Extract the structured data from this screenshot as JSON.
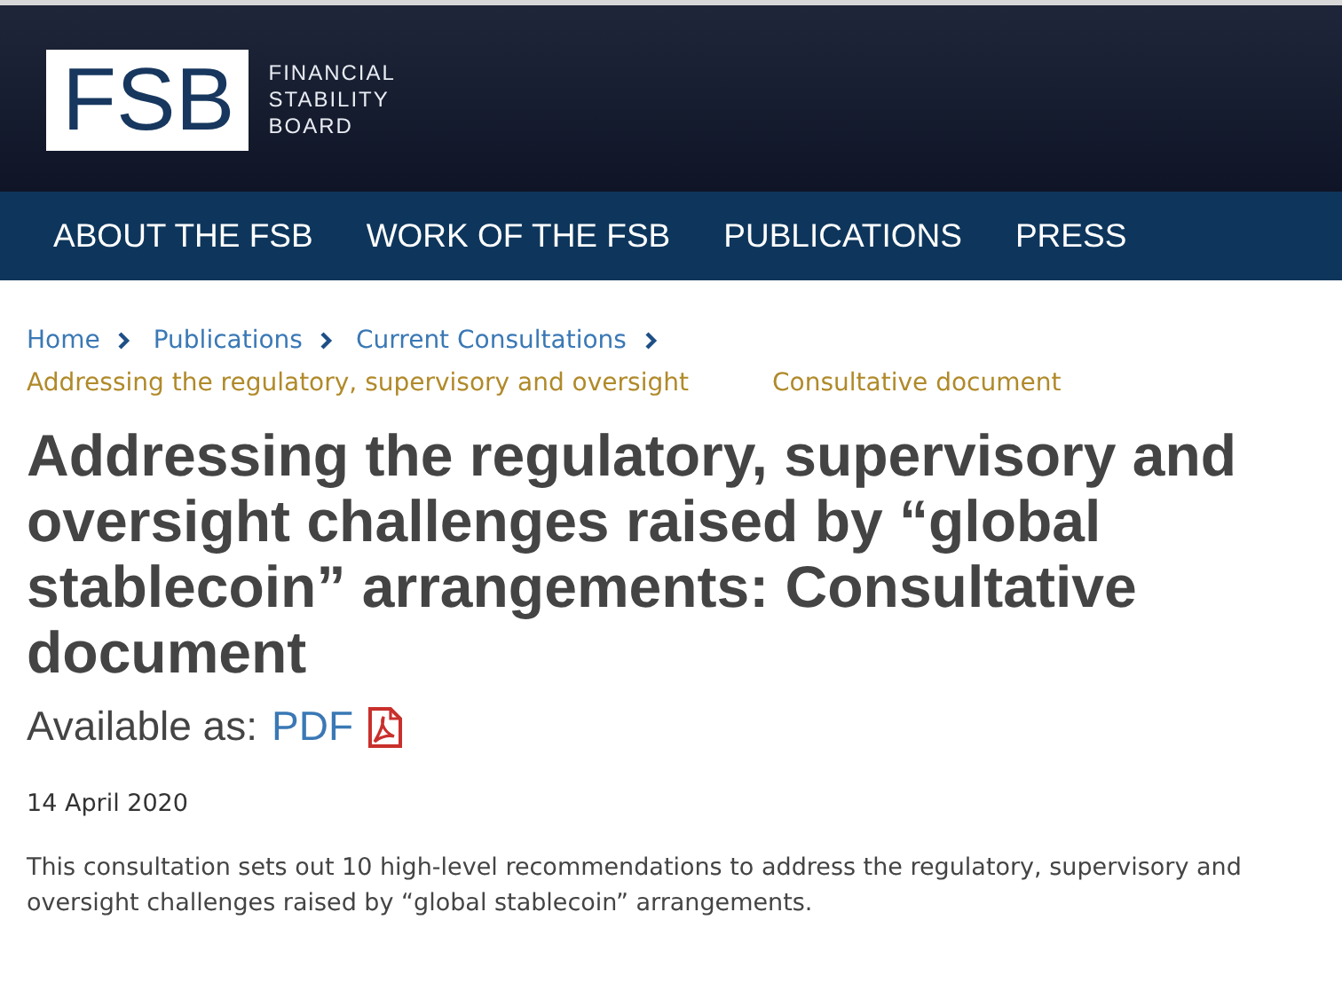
{
  "logo": {
    "mark": "FSB",
    "name_lines": [
      "FINANCIAL",
      "STABILITY",
      "BOARD"
    ]
  },
  "nav": [
    {
      "label": "ABOUT THE FSB"
    },
    {
      "label": "WORK OF THE FSB"
    },
    {
      "label": "PUBLICATIONS"
    },
    {
      "label": "PRESS"
    }
  ],
  "breadcrumb": {
    "links": [
      "Home",
      "Publications",
      "Current Consultations"
    ],
    "current_lines": [
      "Addressing the regulatory, supervisory and oversight",
      "Consultative document"
    ]
  },
  "title": "Addressing the regulatory, supervisory and oversight challenges raised by “global stablecoin” arrangements: Consultative document",
  "available": {
    "label": "Available as:",
    "link": "PDF"
  },
  "date": "14 April 2020",
  "summary": "This consultation sets out 10 high-level recommendations to address the regulatory, supervisory and oversight challenges raised by “global stablecoin” arrangements."
}
